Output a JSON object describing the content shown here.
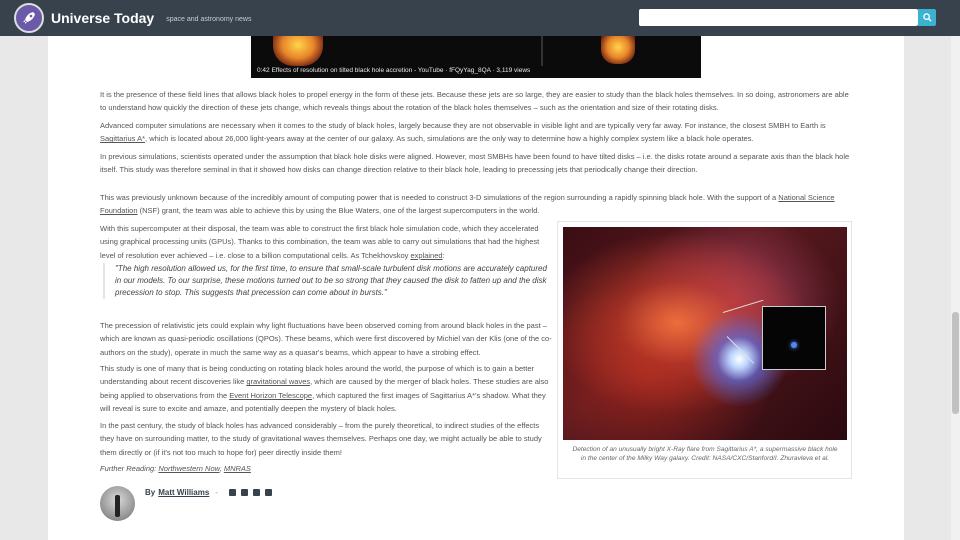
{
  "header": {
    "site_name": "Universe Today",
    "tagline": "space and astronomy news",
    "search_placeholder": ""
  },
  "video": {
    "caption": "0:42 Effects of resolution on tilted black hole accretion - YouTube · fFQyYag_8QA · 3,119 views"
  },
  "article": {
    "p1": "It is the presence of these field lines that allows black holes to propel energy in the form of these jets. Because these jets are so large, they are easier to study than the black holes themselves. In so doing, astronomers are able to understand how quickly the direction of these jets change, which reveals things about the rotation of the black holes themselves – such as the orientation and size of their rotating disks.",
    "p2_a": "Advanced computer simulations are necessary when it comes to the study of black holes, largely because they are not observable in visible light and are typically very far away. For instance, the closest SMBH to Earth is ",
    "p2_link": "Sagittarius A*",
    "p2_b": ", which is located about 26,000 light-years away at the center of our galaxy. As such, simulations are the only way to determine how a highly complex system like a black hole operates.",
    "p3": "In previous simulations, scientists operated under the assumption that black hole disks were aligned. However, most SMBHs have been found to have tilted disks – i.e. the disks rotate around a separate axis than the black hole itself. This study was therefore seminal in that it showed how disks can change direction relative to their black hole, leading to precessing jets that periodically change their direction.",
    "p4_a": "This was previously unknown because of the incredibly amount of computing power that is needed to construct 3-D simulations of the region surrounding a rapidly spinning black hole. With the support of a ",
    "p4_link": "National Science Foundation",
    "p4_b": " (NSF) grant, the team was able to achieve this by using the Blue Waters, one of the largest supercomputers in the world.",
    "p5_a": "With this supercomputer at their disposal, the team was able to construct the first black hole simulation code, which they accelerated using graphical processing units (GPUs). Thanks to this combination, the team was able to carry out simulations that had the highest level of resolution ever achieved – i.e. close to a billion computational cells. As Tchekhovskoy ",
    "p5_link": "explained",
    "p5_b": ":",
    "quote": "\"The high resolution allowed us, for the first time, to ensure that small-scale turbulent disk motions are accurately captured in our models. To our surprise, these motions turned out to be so strong that they caused the disk to fatten up and the disk precession to stop. This suggests that precession can come about in bursts.\"",
    "p6": "The precession of relativistic jets could explain why light fluctuations have been observed coming from around black holes in the past – which are known as quasi-periodic oscillations (QPOs). These beams, which were first discovered by Michiel van der Klis (one of the co-authors on the study), operate in much the same way as a quasar's beams, which appear to have a strobing effect.",
    "p7_a": "This study is one of many that is being conducting on rotating black holes around the world, the purpose of which is to gain a better understanding about recent discoveries like ",
    "p7_link1": "gravitational waves",
    "p7_b": ", which are caused by the merger of black holes. These studies are also being applied to observations from the ",
    "p7_link2": "Event Horizon Telescope",
    "p7_c": ", which captured the first images of Sagittarius A*'s shadow. What they will reveal is sure to excite and amaze, and potentially deepen the mystery of black holes.",
    "p8": "In the past century, the study of black holes has advanced considerably – from the purely theoretical, to indirect studies of the effects they have on surrounding matter, to the study of gravitational waves themselves. Perhaps one day, we might actually be able to study them directly or (if it's not too much to hope for) peer directly inside them!",
    "further_label": "Further Reading: ",
    "further_link1": "Northwestern Now",
    "further_sep": ", ",
    "further_link2": "MNRAS"
  },
  "figure": {
    "caption": "Detection of an unusually bright X-Ray flare from Sagittarius A*, a supermassive black hole in the center of the Milky Way galaxy. Credit: NASA/CXC/Stanford/I. Zhuravleva et al."
  },
  "author": {
    "by": "By",
    "name": "Matt Williams",
    "sep": "-"
  }
}
